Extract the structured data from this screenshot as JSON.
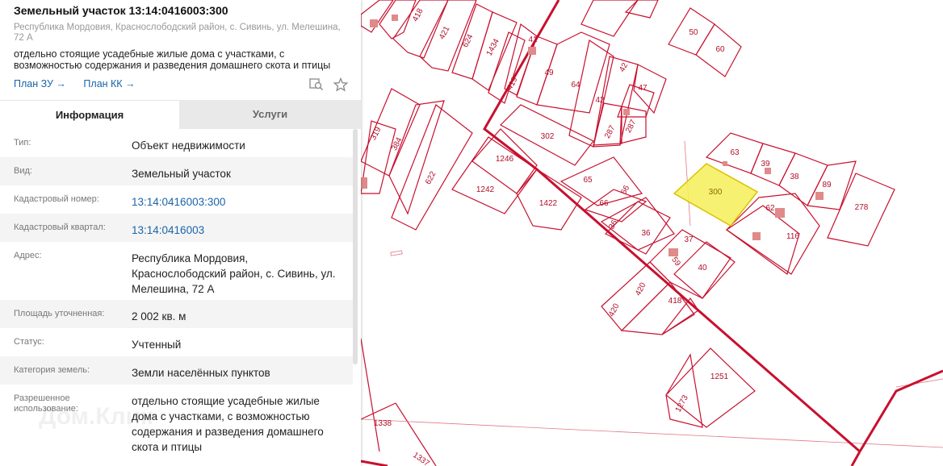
{
  "header": {
    "title": "Земельный участок 13:14:0416003:300",
    "address": "Республика Мордовия, Краснослободский район, с. Сивинь, ул. Мелешина, 72 А",
    "use": "отдельно стоящие усадебные жилые дома с участками, с возможностью содержания и разведения домашнего скота и птицы",
    "link_plan_zu": "План ЗУ →",
    "link_plan_kk": "План КК →"
  },
  "tabs": {
    "info": "Информация",
    "services": "Услуги"
  },
  "rows": [
    {
      "label": "Тип:",
      "value": "Объект недвижимости"
    },
    {
      "label": "Вид:",
      "value": "Земельный участок"
    },
    {
      "label": "Кадастровый номер:",
      "value": "13:14:0416003:300"
    },
    {
      "label": "Кадастровый квартал:",
      "value": "13:14:0416003"
    },
    {
      "label": "Адрес:",
      "value": "Республика Мордовия, Краснослободский район, с. Сивинь, ул. Мелешина, 72 А"
    },
    {
      "label": "Площадь уточненная:",
      "value": "2 002 кв. м"
    },
    {
      "label": "Статус:",
      "value": "Учтенный"
    },
    {
      "label": "Категория земель:",
      "value": "Земли населённых пунктов"
    },
    {
      "label": "Разрешенное использование:",
      "value": "отдельно стоящие усадебные жилые дома с участками, с возможностью содержания и разведения домашнего скота и птицы"
    }
  ],
  "watermark": "Дом.Клик",
  "map": {
    "parcel_labels": [
      "418",
      "421",
      "624",
      "1434",
      "41",
      "419",
      "49",
      "64",
      "42",
      "42",
      "47",
      "287",
      "287",
      "302",
      "50",
      "60",
      "319",
      "384",
      "622",
      "1246",
      "1242",
      "1422",
      "65",
      "66",
      "66",
      "36",
      "36",
      "63",
      "39",
      "38",
      "89",
      "278",
      "300",
      "62",
      "116",
      "37",
      "59",
      "40",
      "420",
      "420",
      "418",
      "1251",
      "1273",
      "1338",
      "1337"
    ],
    "selected_parcel": "300",
    "colors": {
      "boundary": "#c8102e",
      "selected_fill": "#f5f060",
      "building": "#e08a8a"
    }
  }
}
